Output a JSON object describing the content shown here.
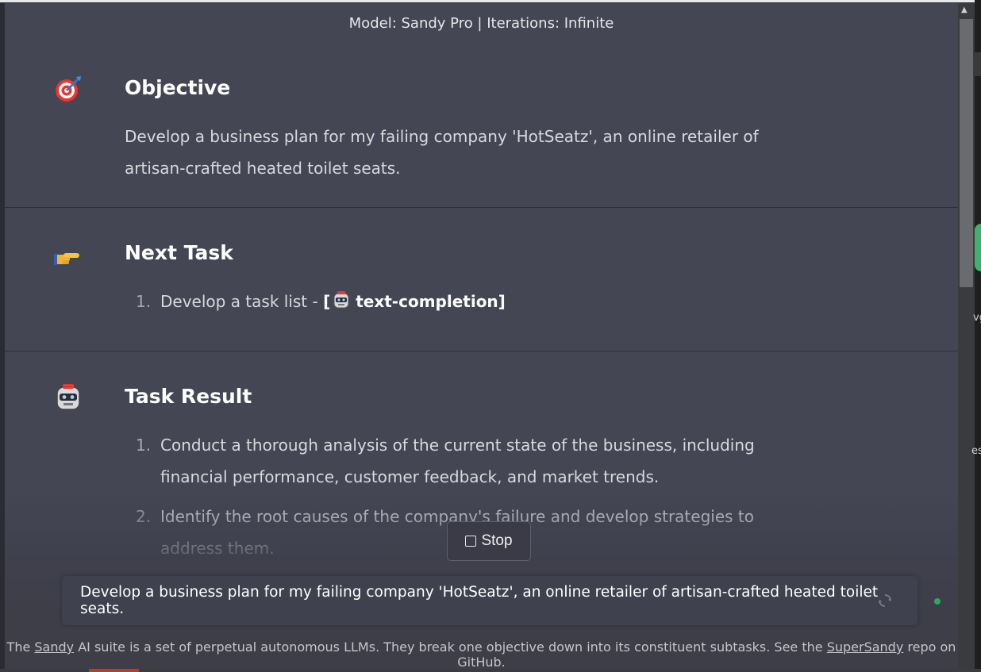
{
  "model_bar": "Model: Sandy Pro | Iterations: Infinite",
  "objective": {
    "icon": "target-icon",
    "title": "Objective",
    "text": "Develop a business plan for my failing company 'HotSeatz', an online retailer of artisan-crafted heated toilet seats."
  },
  "next_task": {
    "icon": "pointing-hand-icon",
    "title": "Next Task",
    "items": [
      {
        "num": "1.",
        "text": "Develop a task list - ",
        "agent_open": "[",
        "agent": "text-completion]"
      }
    ]
  },
  "task_result": {
    "icon": "robot-icon",
    "title": "Task Result",
    "items": [
      {
        "num": "1.",
        "text": "Conduct a thorough analysis of the current state of the business, including financial performance, customer feedback, and market trends."
      },
      {
        "num": "2.",
        "text": "Identify the root causes of the company's failure and develop strategies to address them."
      }
    ]
  },
  "stop_button": "Stop",
  "input": {
    "value": "Develop a business plan for my failing company 'HotSeatz', an online retailer of artisan-crafted heated toilet seats."
  },
  "footer": {
    "pre": "The ",
    "link1": "Sandy",
    "mid": " AI suite is a set of perpetual autonomous LLMs. They break one objective down into its constituent subtasks. See the ",
    "link2": "SuperSandy",
    "post": " repo on GitHub."
  },
  "background_window": {
    "text1": "vg",
    "text2": "es"
  },
  "colors": {
    "panel": "#444654",
    "status": "#2ea766",
    "text": "#d8d9de"
  }
}
